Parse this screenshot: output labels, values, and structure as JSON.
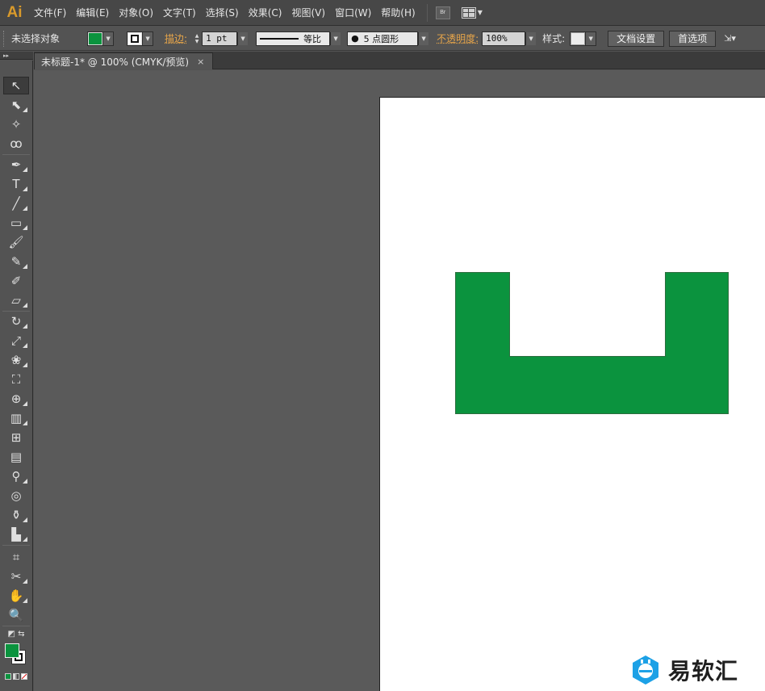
{
  "app": {
    "logo": "Ai"
  },
  "menu": [
    "文件(F)",
    "编辑(E)",
    "对象(O)",
    "文字(T)",
    "选择(S)",
    "效果(C)",
    "视图(V)",
    "窗口(W)",
    "帮助(H)"
  ],
  "menu_extra": {
    "bridge_label": "Br"
  },
  "control": {
    "selection_status": "未选择对象",
    "fill_color": "#0b933e",
    "stroke_label": "描边:",
    "stroke_weight": "1 pt",
    "profile_label": "等比",
    "brush_label": "5 点圆形",
    "opacity_label": "不透明度:",
    "opacity_value": "100%",
    "style_label": "样式:",
    "doc_setup_button": "文档设置",
    "preferences_button": "首选项"
  },
  "document": {
    "tab_title": "未标题-1* @ 100% (CMYK/预览)",
    "tab_close": "×"
  },
  "tools": [
    "selection-tool",
    "direct-selection-tool",
    "magic-wand-tool",
    "lasso-tool",
    "pen-tool",
    "type-tool",
    "line-segment-tool",
    "rectangle-tool",
    "paintbrush-tool",
    "pencil-tool",
    "blob-brush-tool",
    "eraser-tool",
    "rotate-tool",
    "scale-tool",
    "warp-tool",
    "free-transform-tool",
    "shape-builder-tool",
    "perspective-grid-tool",
    "mesh-tool",
    "gradient-tool",
    "eyedropper-tool",
    "blend-tool",
    "symbol-sprayer-tool",
    "column-graph-tool",
    "artboard-tool",
    "slice-tool",
    "hand-tool",
    "zoom-tool"
  ],
  "colors": {
    "shape_fill": "#0b933e",
    "shape_stroke": "#2d6d3f",
    "accent_orange": "#e8a64a",
    "artboard": "#ffffff",
    "canvas_bg": "#5a5a5a"
  },
  "watermark": {
    "text": "易软汇"
  }
}
